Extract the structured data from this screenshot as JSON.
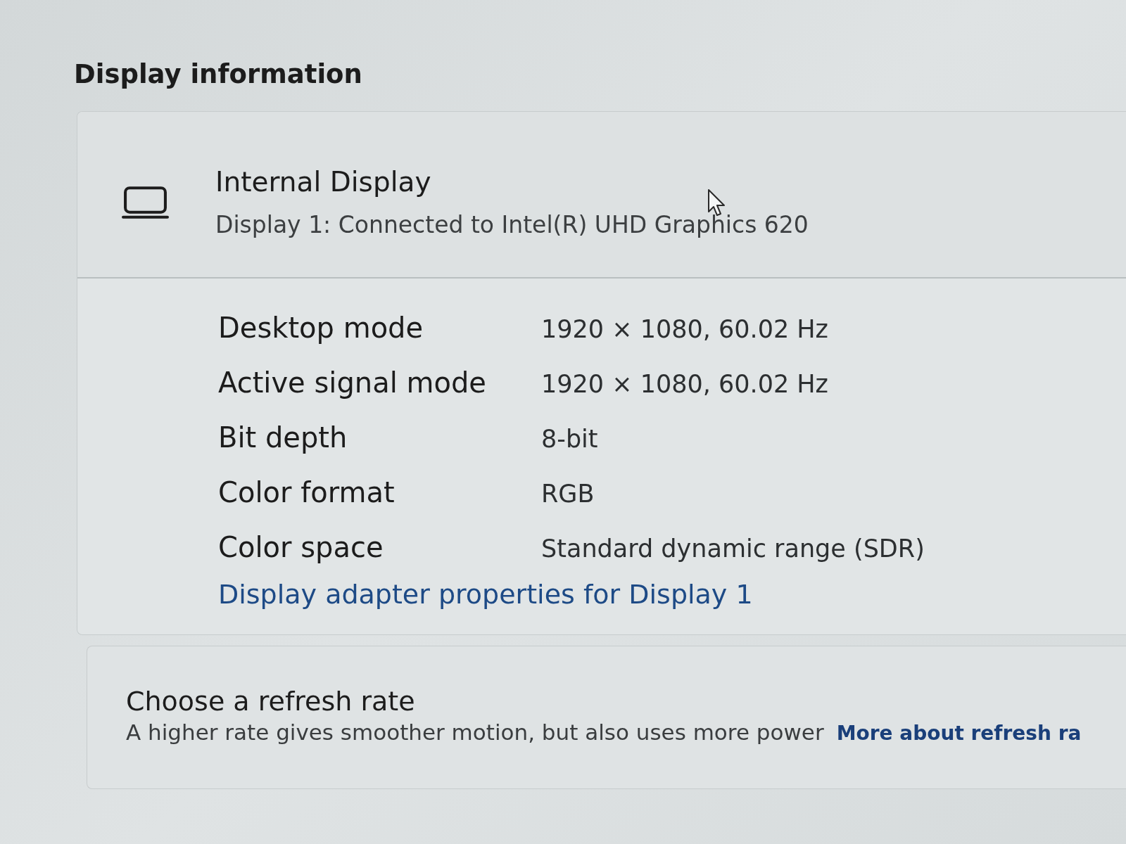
{
  "section_title": "Display information",
  "display": {
    "name": "Internal Display",
    "description": "Display 1: Connected to Intel(R) UHD Graphics 620"
  },
  "properties": [
    {
      "label": "Desktop mode",
      "value": "1920 × 1080, 60.02 Hz"
    },
    {
      "label": "Active signal mode",
      "value": "1920 × 1080, 60.02 Hz"
    },
    {
      "label": "Bit depth",
      "value": "8-bit"
    },
    {
      "label": "Color format",
      "value": "RGB"
    },
    {
      "label": "Color space",
      "value": "Standard dynamic range (SDR)"
    }
  ],
  "adapter_link": "Display adapter properties for Display 1",
  "refresh_rate": {
    "title": "Choose a refresh rate",
    "description": "A higher rate gives smoother motion, but also uses more power",
    "link": "More about refresh ra"
  }
}
